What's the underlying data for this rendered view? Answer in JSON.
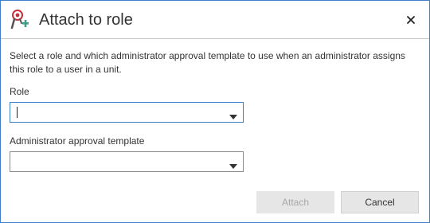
{
  "dialog": {
    "title": "Attach to role",
    "title_icon": "role-attach-icon",
    "close_icon": "close-icon",
    "description": "Select a role and which administrator approval template to use when an administrator assigns this role to a user in a unit."
  },
  "fields": {
    "role": {
      "label": "Role",
      "value": ""
    },
    "approval_template": {
      "label": "Administrator approval template",
      "value": ""
    }
  },
  "buttons": {
    "attach": "Attach",
    "cancel": "Cancel"
  },
  "colors": {
    "accent": "#3c7fc6",
    "icon_red": "#c8313b",
    "icon_teal": "#3f9d8a"
  }
}
